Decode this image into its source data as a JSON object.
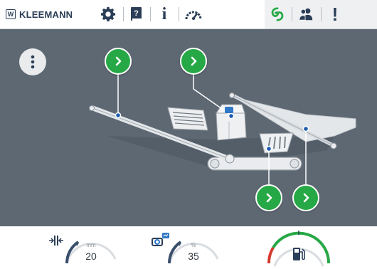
{
  "app": {
    "logo_text": "KLEEMANN",
    "logo_mark": "W"
  },
  "toolbar": {
    "icons": [
      "gear-icon",
      "manual-icon",
      "info-icon",
      "speedometer-icon",
      "eco-icon",
      "users-icon",
      "alert-icon"
    ],
    "info_glyph": "i",
    "manual_glyph": "?",
    "alert_glyph": "!"
  },
  "colors": {
    "accent_green": "#27a846",
    "background": "#5e6873",
    "brand": "#2b3e57"
  },
  "gauges": [
    {
      "id": "crusher-gap",
      "icon": "crusher-gap-icon",
      "unit": "mm",
      "value": "20"
    },
    {
      "id": "feeder-speed",
      "icon": "feeder-icon",
      "unit": "%",
      "value": "35"
    },
    {
      "id": "fuel-level",
      "icon": "fuel-pump-icon",
      "unit": "",
      "value": ""
    }
  ]
}
